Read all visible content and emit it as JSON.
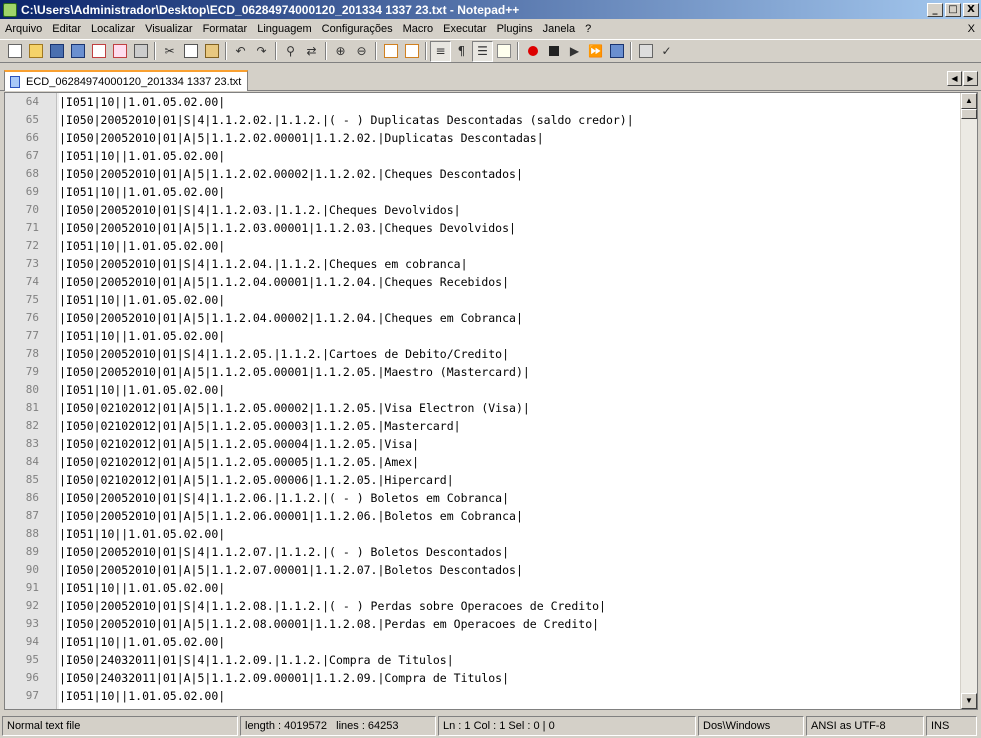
{
  "window": {
    "title": "C:\\Users\\Administrador\\Desktop\\ECD_06284974000120_201334 1337 23.txt - Notepad++",
    "min": "_",
    "max": "□",
    "close": "X"
  },
  "menu": [
    "Arquivo",
    "Editar",
    "Localizar",
    "Visualizar",
    "Formatar",
    "Linguagem",
    "Configurações",
    "Macro",
    "Executar",
    "Plugins",
    "Janela",
    "?"
  ],
  "menu_close": "X",
  "tab": {
    "label": "ECD_06284974000120_201334 1337 23.txt"
  },
  "editor": {
    "lines": [
      {
        "n": "64",
        "t": "|I051|10||1.01.05.02.00|"
      },
      {
        "n": "65",
        "t": "|I050|20052010|01|S|4|1.1.2.02.|1.1.2.|( - ) Duplicatas Descontadas (saldo credor)|"
      },
      {
        "n": "66",
        "t": "|I050|20052010|01|A|5|1.1.2.02.00001|1.1.2.02.|Duplicatas Descontadas|"
      },
      {
        "n": "67",
        "t": "|I051|10||1.01.05.02.00|"
      },
      {
        "n": "68",
        "t": "|I050|20052010|01|A|5|1.1.2.02.00002|1.1.2.02.|Cheques Descontados|"
      },
      {
        "n": "69",
        "t": "|I051|10||1.01.05.02.00|"
      },
      {
        "n": "70",
        "t": "|I050|20052010|01|S|4|1.1.2.03.|1.1.2.|Cheques Devolvidos|"
      },
      {
        "n": "71",
        "t": "|I050|20052010|01|A|5|1.1.2.03.00001|1.1.2.03.|Cheques Devolvidos|"
      },
      {
        "n": "72",
        "t": "|I051|10||1.01.05.02.00|"
      },
      {
        "n": "73",
        "t": "|I050|20052010|01|S|4|1.1.2.04.|1.1.2.|Cheques em cobranca|"
      },
      {
        "n": "74",
        "t": "|I050|20052010|01|A|5|1.1.2.04.00001|1.1.2.04.|Cheques Recebidos|"
      },
      {
        "n": "75",
        "t": "|I051|10||1.01.05.02.00|"
      },
      {
        "n": "76",
        "t": "|I050|20052010|01|A|5|1.1.2.04.00002|1.1.2.04.|Cheques em Cobranca|"
      },
      {
        "n": "77",
        "t": "|I051|10||1.01.05.02.00|"
      },
      {
        "n": "78",
        "t": "|I050|20052010|01|S|4|1.1.2.05.|1.1.2.|Cartoes de Debito/Credito|"
      },
      {
        "n": "79",
        "t": "|I050|20052010|01|A|5|1.1.2.05.00001|1.1.2.05.|Maestro (Mastercard)|"
      },
      {
        "n": "80",
        "t": "|I051|10||1.01.05.02.00|"
      },
      {
        "n": "81",
        "t": "|I050|02102012|01|A|5|1.1.2.05.00002|1.1.2.05.|Visa Electron (Visa)|"
      },
      {
        "n": "82",
        "t": "|I050|02102012|01|A|5|1.1.2.05.00003|1.1.2.05.|Mastercard|"
      },
      {
        "n": "83",
        "t": "|I050|02102012|01|A|5|1.1.2.05.00004|1.1.2.05.|Visa|"
      },
      {
        "n": "84",
        "t": "|I050|02102012|01|A|5|1.1.2.05.00005|1.1.2.05.|Amex|"
      },
      {
        "n": "85",
        "t": "|I050|02102012|01|A|5|1.1.2.05.00006|1.1.2.05.|Hipercard|"
      },
      {
        "n": "86",
        "t": "|I050|20052010|01|S|4|1.1.2.06.|1.1.2.|( - ) Boletos em Cobranca|"
      },
      {
        "n": "87",
        "t": "|I050|20052010|01|A|5|1.1.2.06.00001|1.1.2.06.|Boletos em Cobranca|"
      },
      {
        "n": "88",
        "t": "|I051|10||1.01.05.02.00|"
      },
      {
        "n": "89",
        "t": "|I050|20052010|01|S|4|1.1.2.07.|1.1.2.|( - ) Boletos Descontados|"
      },
      {
        "n": "90",
        "t": "|I050|20052010|01|A|5|1.1.2.07.00001|1.1.2.07.|Boletos Descontados|"
      },
      {
        "n": "91",
        "t": "|I051|10||1.01.05.02.00|"
      },
      {
        "n": "92",
        "t": "|I050|20052010|01|S|4|1.1.2.08.|1.1.2.|( - ) Perdas sobre Operacoes de Credito|"
      },
      {
        "n": "93",
        "t": "|I050|20052010|01|A|5|1.1.2.08.00001|1.1.2.08.|Perdas em Operacoes de Credito|"
      },
      {
        "n": "94",
        "t": "|I051|10||1.01.05.02.00|"
      },
      {
        "n": "95",
        "t": "|I050|24032011|01|S|4|1.1.2.09.|1.1.2.|Compra de Titulos|"
      },
      {
        "n": "96",
        "t": "|I050|24032011|01|A|5|1.1.2.09.00001|1.1.2.09.|Compra de Titulos|"
      },
      {
        "n": "97",
        "t": "|I051|10||1.01.05.02.00|"
      }
    ]
  },
  "status": {
    "type": "Normal text file",
    "length": "length : 4019572",
    "lines": "lines : 64253",
    "position": "Ln : 1    Col : 1    Sel : 0 | 0",
    "eol": "Dos\\Windows",
    "encoding": "ANSI as UTF-8",
    "mode": "INS"
  },
  "toolbar_icons": [
    "new-file-icon",
    "open-file-icon",
    "save-icon",
    "save-all-icon",
    "close-icon",
    "close-all-icon",
    "print-icon",
    "cut-icon",
    "copy-icon",
    "paste-icon",
    "undo-icon",
    "redo-icon",
    "find-icon",
    "replace-icon",
    "zoom-in-icon",
    "zoom-out-icon",
    "sync-vertical-icon",
    "sync-horizontal-icon",
    "word-wrap-icon",
    "show-all-chars-icon",
    "indent-guide-icon",
    "doc-map-icon",
    "record-macro-icon",
    "stop-macro-icon",
    "play-macro-icon",
    "run-macro-multiple-icon",
    "save-macro-icon",
    "spell-check-icon",
    "abc-check-icon"
  ],
  "colors": {
    "titlebar_start": "#0a246a",
    "titlebar_end": "#a6caf0",
    "tab_accent": "#f9a030",
    "chrome": "#d4d0c8"
  }
}
